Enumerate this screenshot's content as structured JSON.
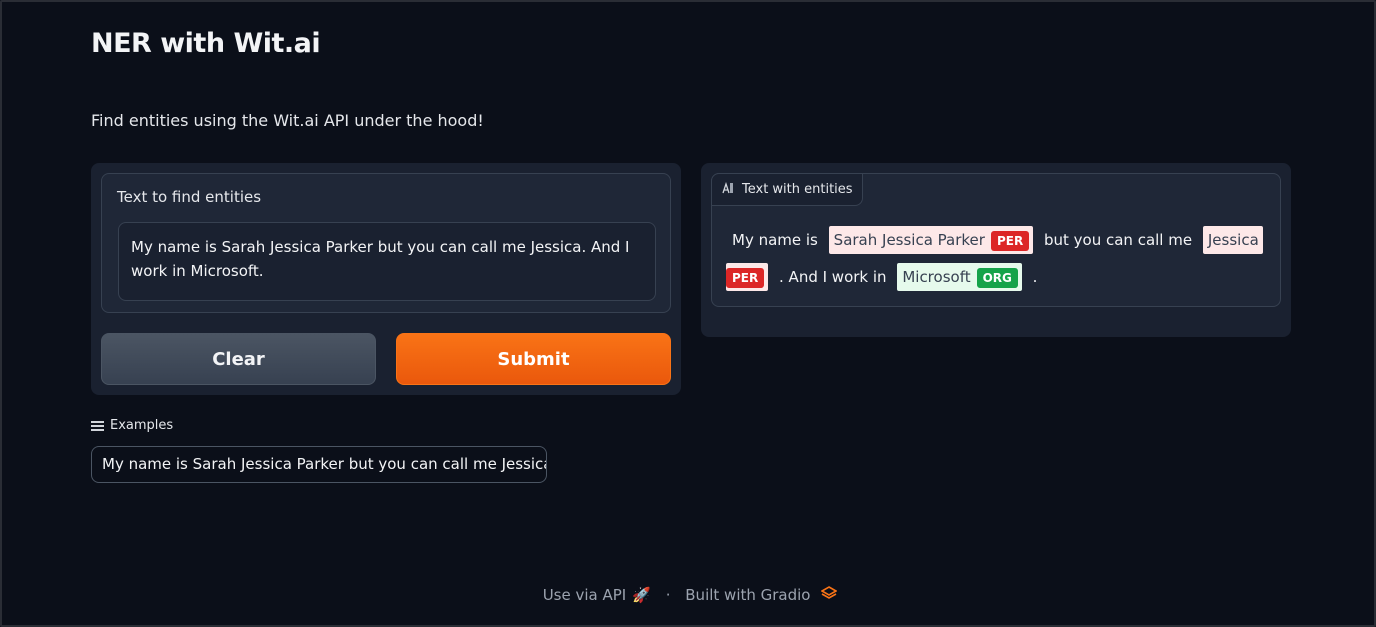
{
  "header": {
    "title": "NER with Wit.ai",
    "description": "Find entities using the Wit.ai API under the hood!"
  },
  "input": {
    "label": "Text to find entities",
    "value": "My name is Sarah Jessica Parker but you can call me Jessica. And I work in Microsoft."
  },
  "buttons": {
    "clear_label": "Clear",
    "submit_label": "Submit"
  },
  "examples": {
    "label": "Examples",
    "items": [
      "My name is Sarah Jessica Parker but you can call me Jessica"
    ]
  },
  "output": {
    "tab_label": "Text with entities",
    "tab_icon": "text-highlight-icon",
    "segments": [
      {
        "text": "My name is",
        "entity": null
      },
      {
        "text": "Sarah Jessica Parker",
        "entity": "PER"
      },
      {
        "text": "but you can call me",
        "entity": null
      },
      {
        "text": "Jessica",
        "entity": "PER"
      },
      {
        "text": ". And I work in",
        "entity": null
      },
      {
        "text": "Microsoft",
        "entity": "ORG"
      },
      {
        "text": ".",
        "entity": null
      }
    ]
  },
  "footer": {
    "api_link": "Use via API",
    "separator": "·",
    "built_with": "Built with Gradio"
  },
  "colors": {
    "background": "#0b0f19",
    "accent": "#f97316",
    "per_tag": "#dc2626",
    "org_tag": "#16a34a"
  }
}
